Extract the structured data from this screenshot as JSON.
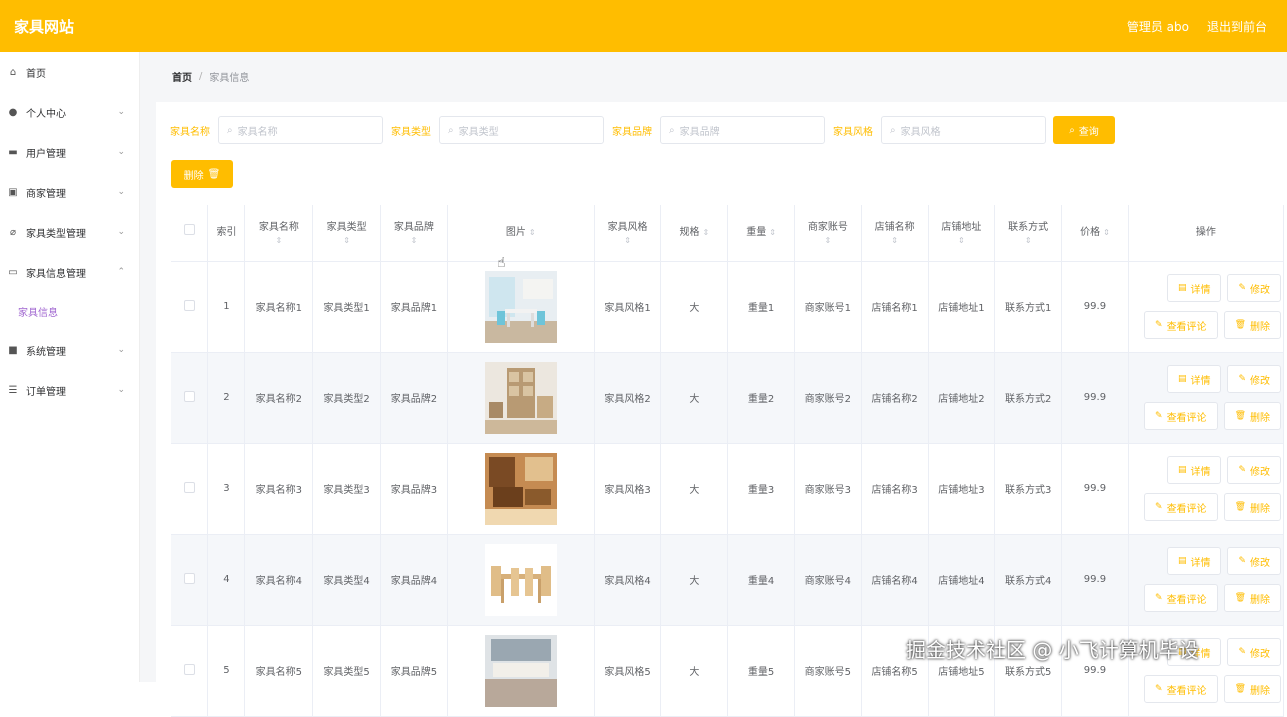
{
  "header": {
    "title": "家具网站",
    "admin": "管理员 abo",
    "exit": "退出到前台"
  },
  "sidebar": {
    "items": [
      {
        "label": "首页",
        "icon": "home-icon",
        "expandable": false
      },
      {
        "label": "个人中心",
        "icon": "user-icon",
        "expandable": true
      },
      {
        "label": "用户管理",
        "icon": "users-icon",
        "expandable": true
      },
      {
        "label": "商家管理",
        "icon": "store-icon",
        "expandable": true
      },
      {
        "label": "家具类型管理",
        "icon": "tag-icon",
        "expandable": true
      },
      {
        "label": "家具信息管理",
        "icon": "info-icon",
        "expandable": true,
        "expanded": true
      },
      {
        "label": "系统管理",
        "icon": "settings-icon",
        "expandable": true
      },
      {
        "label": "订单管理",
        "icon": "list-icon",
        "expandable": true
      }
    ],
    "submenu": {
      "label": "家具信息"
    }
  },
  "breadcrumb": {
    "home": "首页",
    "separator": "/",
    "current": "家具信息"
  },
  "search": {
    "fields": [
      {
        "label": "家具名称",
        "placeholder": "家具名称"
      },
      {
        "label": "家具类型",
        "placeholder": "家具类型"
      },
      {
        "label": "家具品牌",
        "placeholder": "家具品牌"
      },
      {
        "label": "家具风格",
        "placeholder": "家具风格"
      }
    ],
    "query_button": "查询"
  },
  "toolbar": {
    "delete_button": "删除"
  },
  "table": {
    "columns": [
      "索引",
      "家具名称",
      "家具类型",
      "家具品牌",
      "图片",
      "家具风格",
      "规格",
      "重量",
      "商家账号",
      "店铺名称",
      "店铺地址",
      "联系方式",
      "价格",
      "操作"
    ],
    "rows": [
      {
        "index": "1",
        "name": "家具名称1",
        "type": "家具类型1",
        "brand": "家具品牌1",
        "style": "家具风格1",
        "spec": "大",
        "weight": "重量1",
        "account": "商家账号1",
        "shop": "店铺名称1",
        "address": "店铺地址1",
        "contact": "联系方式1",
        "price": "99.9"
      },
      {
        "index": "2",
        "name": "家具名称2",
        "type": "家具类型2",
        "brand": "家具品牌2",
        "style": "家具风格2",
        "spec": "大",
        "weight": "重量2",
        "account": "商家账号2",
        "shop": "店铺名称2",
        "address": "店铺地址2",
        "contact": "联系方式2",
        "price": "99.9"
      },
      {
        "index": "3",
        "name": "家具名称3",
        "type": "家具类型3",
        "brand": "家具品牌3",
        "style": "家具风格3",
        "spec": "大",
        "weight": "重量3",
        "account": "商家账号3",
        "shop": "店铺名称3",
        "address": "店铺地址3",
        "contact": "联系方式3",
        "price": "99.9"
      },
      {
        "index": "4",
        "name": "家具名称4",
        "type": "家具类型4",
        "brand": "家具品牌4",
        "style": "家具风格4",
        "spec": "大",
        "weight": "重量4",
        "account": "商家账号4",
        "shop": "店铺名称4",
        "address": "店铺地址4",
        "contact": "联系方式4",
        "price": "99.9"
      },
      {
        "index": "5",
        "name": "家具名称5",
        "type": "家具类型5",
        "brand": "家具品牌5",
        "style": "家具风格5",
        "spec": "大",
        "weight": "重量5",
        "account": "商家账号5",
        "shop": "店铺名称5",
        "address": "店铺地址5",
        "contact": "联系方式5",
        "price": "99.9"
      }
    ],
    "actions": {
      "detail": "详情",
      "edit": "修改",
      "reviews": "查看评论",
      "delete": "删除"
    }
  },
  "watermark": "掘金技术社区 @ 小飞计算机毕设",
  "colors": {
    "accent": "#ffbd00",
    "submenu_active": "#a066d0"
  }
}
